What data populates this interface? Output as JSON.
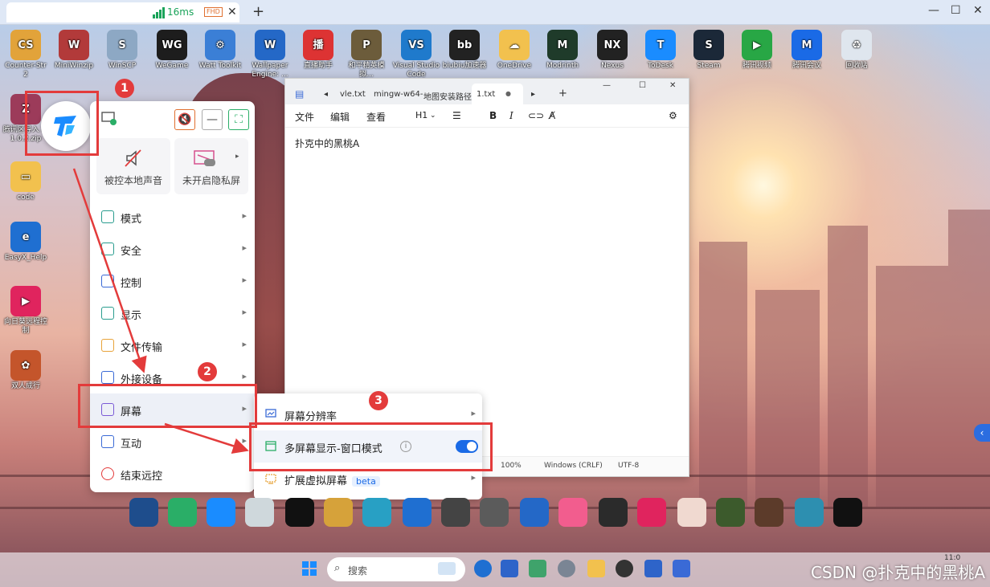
{
  "topbar": {
    "latency": "16ms",
    "quality_badge": "FHD",
    "close_tab": "✕",
    "new_tab": "+",
    "win_min": "—",
    "win_max": "☐",
    "win_close": "✕"
  },
  "desktop_icons": [
    {
      "label": "Counter-Str 2",
      "color": "#e2a33a",
      "glyph": "CS"
    },
    {
      "label": "MiniWinzip",
      "color": "#b23a3a",
      "glyph": "W"
    },
    {
      "label": "WinSCP",
      "color": "#8da8c4",
      "glyph": "S"
    },
    {
      "label": "WeGame",
      "color": "#1d1d1d",
      "glyph": "WG"
    },
    {
      "label": "Watt Toolkit",
      "color": "#3b7fd6",
      "glyph": "⚙"
    },
    {
      "label": "Wallpaper Engine: ...",
      "color": "#2468c7",
      "glyph": "W"
    },
    {
      "label": "直播助手",
      "color": "#d33",
      "glyph": "播"
    },
    {
      "label": "和平精英模拟...",
      "color": "#6c5c3b",
      "glyph": "P"
    },
    {
      "label": "Visual Studio Code",
      "color": "#1f7acc",
      "glyph": "VS"
    },
    {
      "label": "biubiu加速器",
      "color": "#222",
      "glyph": "bb"
    },
    {
      "label": "OneDrive",
      "color": "#f2c14e",
      "glyph": "☁"
    },
    {
      "label": "Modrinth",
      "color": "#1f3b2a",
      "glyph": "M"
    },
    {
      "label": "Nexus",
      "color": "#222",
      "glyph": "NX"
    },
    {
      "label": "ToDesk",
      "color": "#1a8cff",
      "glyph": "T"
    },
    {
      "label": "Steam",
      "color": "#1b2838",
      "glyph": "S"
    },
    {
      "label": "腾讯视频",
      "color": "#28a745",
      "glyph": "▶"
    },
    {
      "label": "腾讯会议",
      "color": "#1a6ae6",
      "glyph": "M"
    },
    {
      "label": "回收站",
      "color": "#dfe6ee",
      "glyph": "♻"
    },
    {
      "label": "腾讯区导入 本1.0.2.zip",
      "color": "#9c3b5a",
      "glyph": "Z"
    },
    {
      "label": "code",
      "color": "#f2c14e",
      "glyph": "▭"
    },
    {
      "label": "EasyX_Help",
      "color": "#1f6fd1",
      "glyph": "e"
    },
    {
      "label": "向日葵远程控制",
      "color": "#e0245e",
      "glyph": "▶"
    },
    {
      "label": "双人成行",
      "color": "#c4552b",
      "glyph": "✿"
    }
  ],
  "notepad": {
    "tabs": [
      "vle.txt",
      "mingw-w64-",
      "地图安装路径",
      "1.txt"
    ],
    "active_dot": "●",
    "new_tab": "+",
    "win_min": "—",
    "win_max": "☐",
    "win_close": "✕",
    "menu": [
      "文件",
      "编辑",
      "查看"
    ],
    "heading_select": "H1",
    "content": "扑克中的黑桃A",
    "status_zoom": "100%",
    "status_eol": "Windows (CRLF)",
    "status_enc": "UTF-8"
  },
  "panel": {
    "sound_card_label": "被控本地声音",
    "privacy_card_label": "未开启隐私屏",
    "menu_items": [
      {
        "label": "模式",
        "icon": "grid-icon",
        "color": "#2a9d8f"
      },
      {
        "label": "安全",
        "icon": "shield-icon",
        "color": "#2a9d8f"
      },
      {
        "label": "控制",
        "icon": "cube-icon",
        "color": "#3a6ad6"
      },
      {
        "label": "显示",
        "icon": "chart-icon",
        "color": "#2a9d8f"
      },
      {
        "label": "文件传输",
        "icon": "folder-icon",
        "color": "#e8a33a"
      },
      {
        "label": "外接设备",
        "icon": "usb-icon",
        "color": "#3a6ad6"
      },
      {
        "label": "屏幕",
        "icon": "screen-icon",
        "color": "#7a5ad6"
      },
      {
        "label": "互动",
        "icon": "chat-icon",
        "color": "#3a6ad6"
      },
      {
        "label": "结束远控",
        "icon": "close-circle-icon",
        "color": "#e33b3b"
      }
    ],
    "arrow": "▸"
  },
  "submenu": {
    "items": [
      {
        "label": "屏幕分辨率"
      },
      {
        "label": "多屏幕显示-窗口模式"
      },
      {
        "label": "扩展虚拟屏幕"
      }
    ],
    "beta": "beta",
    "toggle_on": true,
    "info": "i"
  },
  "annotations": [
    "1",
    "2",
    "3"
  ],
  "dock_icons": [
    {
      "name": "PCL",
      "color": "#1e4d8c"
    },
    {
      "name": "WeChat",
      "color": "#2aae67"
    },
    {
      "name": "Windows",
      "color": "#1a8cff"
    },
    {
      "name": "Anime",
      "color": "#cfd8dc"
    },
    {
      "name": "TikTok",
      "color": "#111"
    },
    {
      "name": "WinRAR",
      "color": "#d6a23a"
    },
    {
      "name": "Arrow",
      "color": "#28a0c4"
    },
    {
      "name": "Edge",
      "color": "#1f6fd1"
    },
    {
      "name": "L4D2",
      "color": "#444"
    },
    {
      "name": "PUBG",
      "color": "#5b5b5b"
    },
    {
      "name": "Wallpaper",
      "color": "#2468c7"
    },
    {
      "name": "bilibili",
      "color": "#f25d8e"
    },
    {
      "name": "Green",
      "color": "#2b2b2b"
    },
    {
      "name": "Sunlogin",
      "color": "#e0245e"
    },
    {
      "name": "Avatar",
      "color": "#f0d9d0"
    },
    {
      "name": "Cart",
      "color": "#3c5a2c"
    },
    {
      "name": "HMCL",
      "color": "#5c3b2a"
    },
    {
      "name": "Cube",
      "color": "#2d8fb0"
    },
    {
      "name": "QQ",
      "color": "#111"
    }
  ],
  "taskbar": {
    "search_placeholder": "搜索",
    "time": "11:0"
  },
  "watermark": "CSDN @扑克中的黑桃A",
  "side_button": "‹",
  "colors": {
    "accent": "#1a6ae6",
    "annotation": "#e33b3b"
  }
}
